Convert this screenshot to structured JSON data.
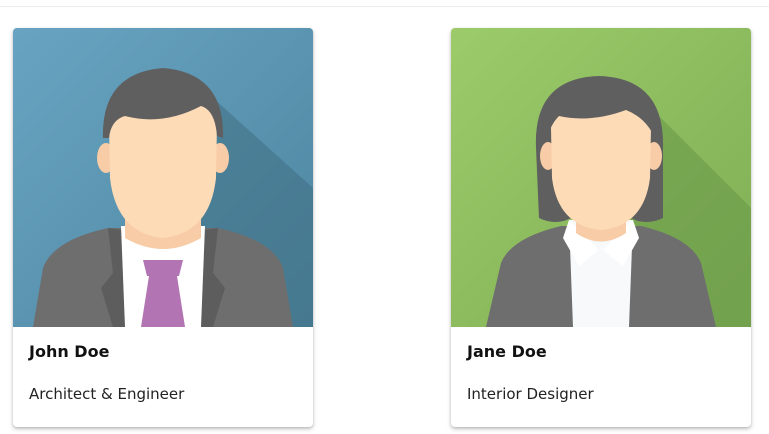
{
  "cards": [
    {
      "name": "John Doe",
      "title": "Architect & Engineer",
      "avatar_icon": "man-avatar-icon",
      "background_color": "#5f98b5"
    },
    {
      "name": "Jane Doe",
      "title": "Interior Designer",
      "avatar_icon": "woman-avatar-icon",
      "background_color": "#8dbb5f"
    }
  ]
}
